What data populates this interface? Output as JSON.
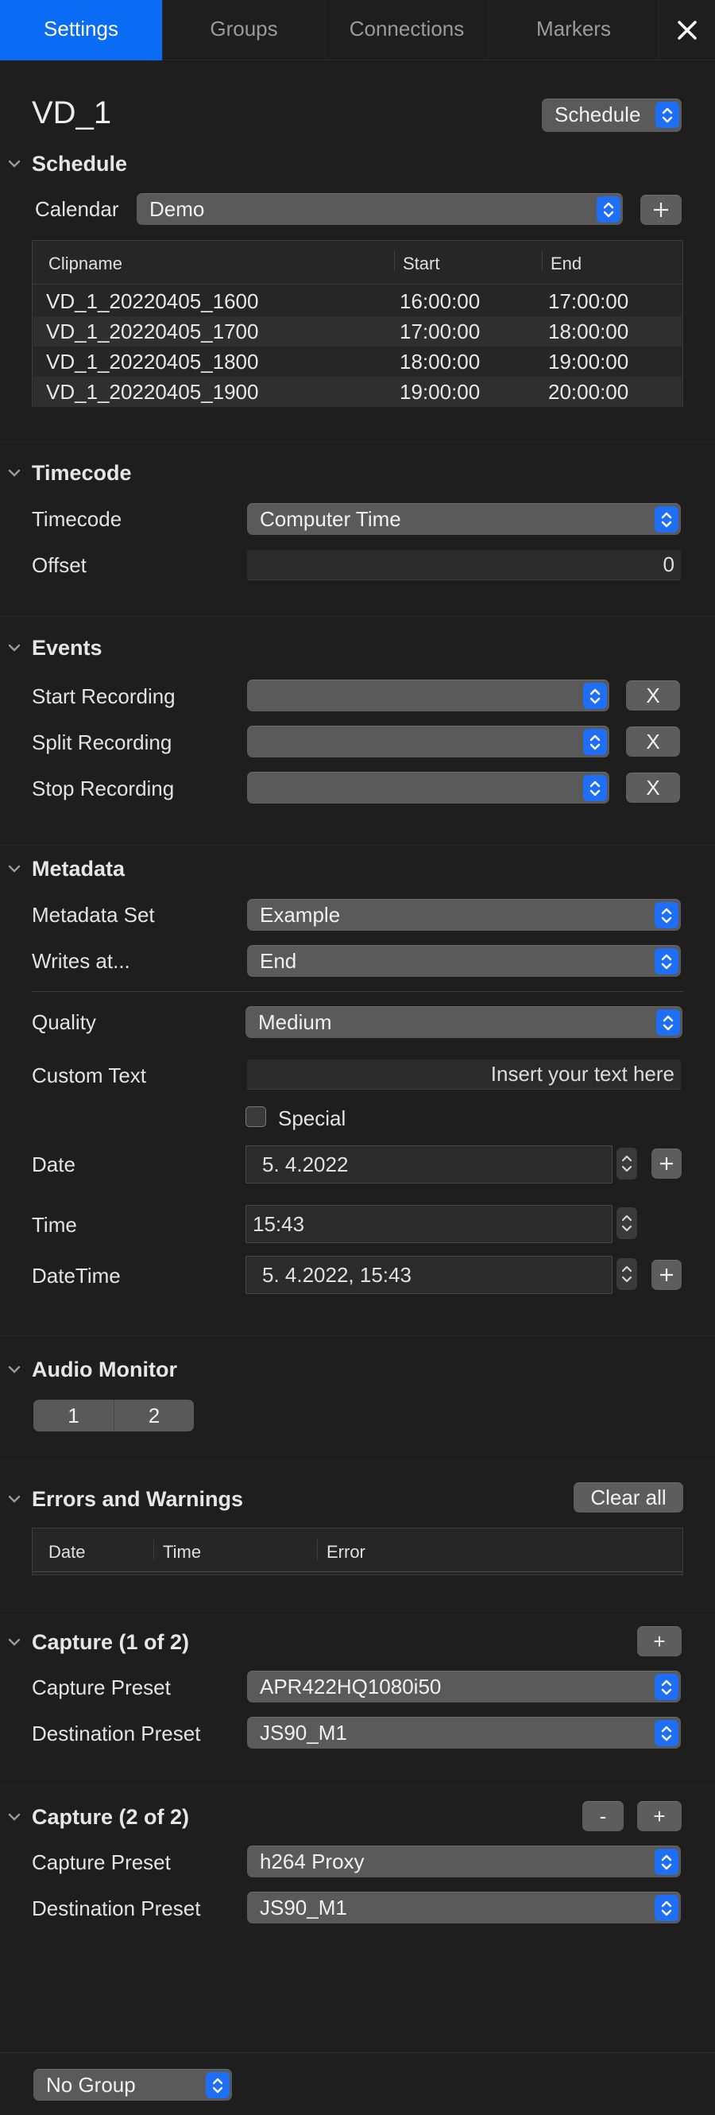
{
  "tabs": [
    "Settings",
    "Groups",
    "Connections",
    "Markers"
  ],
  "device_title": "VD_1",
  "mode_popup": "Schedule",
  "schedule": {
    "header": "Schedule",
    "calendar_label": "Calendar",
    "calendar_value": "Demo",
    "columns": [
      "Clipname",
      "Start",
      "End"
    ],
    "rows": [
      [
        "VD_1_20220405_1600",
        "16:00:00",
        "17:00:00"
      ],
      [
        "VD_1_20220405_1700",
        "17:00:00",
        "18:00:00"
      ],
      [
        "VD_1_20220405_1800",
        "18:00:00",
        "19:00:00"
      ],
      [
        "VD_1_20220405_1900",
        "19:00:00",
        "20:00:00"
      ]
    ]
  },
  "timecode": {
    "header": "Timecode",
    "timecode_label": "Timecode",
    "timecode_value": "Computer Time",
    "offset_label": "Offset",
    "offset_value": "0"
  },
  "events": {
    "header": "Events",
    "items": [
      {
        "label": "Start Recording",
        "value": "",
        "clear": "X"
      },
      {
        "label": "Split Recording",
        "value": "",
        "clear": "X"
      },
      {
        "label": "Stop Recording",
        "value": "",
        "clear": "X"
      }
    ]
  },
  "metadata": {
    "header": "Metadata",
    "set_label": "Metadata Set",
    "set_value": "Example",
    "writes_label": "Writes at...",
    "writes_value": "End",
    "quality_label": "Quality",
    "quality_value": "Medium",
    "custom_label": "Custom Text",
    "custom_placeholder": "Insert your text here",
    "special_label": "Special",
    "special_checked": false,
    "date_label": "Date",
    "date_value": "5. 4.2022",
    "time_label": "Time",
    "time_value": "15:43",
    "datetime_label": "DateTime",
    "datetime_value": "5. 4.2022,  15:43"
  },
  "audio_monitor": {
    "header": "Audio Monitor",
    "channels": [
      "1",
      "2"
    ]
  },
  "errors": {
    "header": "Errors and Warnings",
    "clear_all": "Clear all",
    "columns": [
      "Date",
      "Time",
      "Error"
    ]
  },
  "captures": [
    {
      "header": "Capture (1 of 2)",
      "capture_label": "Capture Preset",
      "capture_value": "APR422HQ1080i50",
      "dest_label": "Destination Preset",
      "dest_value": "JS90_M1",
      "add": "+"
    },
    {
      "header": "Capture (2 of 2)",
      "capture_label": "Capture Preset",
      "capture_value": "h264 Proxy",
      "dest_label": "Destination Preset",
      "dest_value": "JS90_M1",
      "add": "+",
      "remove": "-"
    }
  ],
  "footer": {
    "group_value": "No Group"
  },
  "colors": {
    "accent": "#0a6cf5",
    "background": "#1e1e1e"
  }
}
